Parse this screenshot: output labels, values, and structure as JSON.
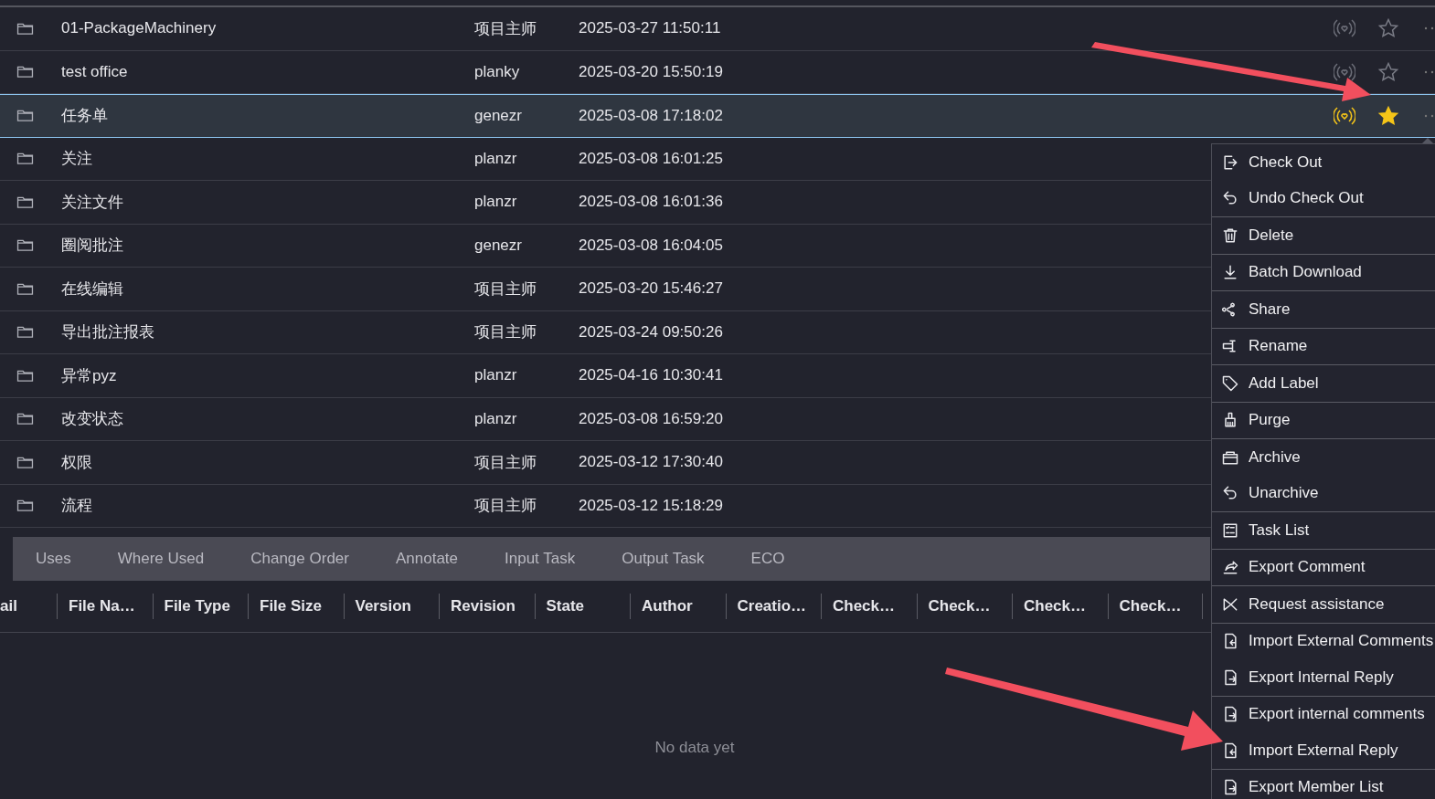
{
  "rows": [
    {
      "name": "01-PackageMachinery",
      "owner": "项目主师",
      "date": "2025-03-27 11:50:11",
      "selected": false,
      "subscribed": false,
      "favorite": false
    },
    {
      "name": "test office",
      "owner": "planky",
      "date": "2025-03-20 15:50:19",
      "selected": false,
      "subscribed": false,
      "favorite": false
    },
    {
      "name": "任务单",
      "owner": "genezr",
      "date": "2025-03-08 17:18:02",
      "selected": true,
      "subscribed": true,
      "favorite": true
    },
    {
      "name": "关注",
      "owner": "planzr",
      "date": "2025-03-08 16:01:25",
      "selected": false
    },
    {
      "name": "关注文件",
      "owner": "planzr",
      "date": "2025-03-08 16:01:36",
      "selected": false
    },
    {
      "name": "圈阅批注",
      "owner": "genezr",
      "date": "2025-03-08 16:04:05",
      "selected": false
    },
    {
      "name": "在线编辑",
      "owner": "项目主师",
      "date": "2025-03-20 15:46:27",
      "selected": false
    },
    {
      "name": "导出批注报表",
      "owner": "项目主师",
      "date": "2025-03-24 09:50:26",
      "selected": false
    },
    {
      "name": "异常pyz",
      "owner": "planzr",
      "date": "2025-04-16 10:30:41",
      "selected": false
    },
    {
      "name": "改变状态",
      "owner": "planzr",
      "date": "2025-03-08 16:59:20",
      "selected": false
    },
    {
      "name": "权限",
      "owner": "项目主师",
      "date": "2025-03-12 17:30:40",
      "selected": false
    },
    {
      "name": "流程",
      "owner": "项目主师",
      "date": "2025-03-12 15:18:29",
      "selected": false
    }
  ],
  "tabs": [
    {
      "label": "Uses",
      "selected": false
    },
    {
      "label": "Where Used",
      "selected": false
    },
    {
      "label": "Change Order",
      "selected": false
    },
    {
      "label": "Annotate",
      "selected": false
    },
    {
      "label": "Input Task",
      "selected": false
    },
    {
      "label": "Output Task",
      "selected": false
    },
    {
      "label": "ECO",
      "selected": false
    }
  ],
  "table": {
    "columns": [
      "ail",
      "File Na…",
      "File Type",
      "File Size",
      "Version",
      "Revision",
      "State",
      "Author",
      "Creatio…",
      "Check…",
      "Check…",
      "Check…",
      "Check…"
    ],
    "empty_text": "No data yet"
  },
  "context_menu": {
    "groups": [
      [
        "Check Out",
        "Undo Check Out"
      ],
      [
        "Delete"
      ],
      [
        "Batch Download"
      ],
      [
        "Share"
      ],
      [
        "Rename"
      ],
      [
        "Add Label"
      ],
      [
        "Purge"
      ],
      [
        "Archive",
        "Unarchive"
      ],
      [
        "Task List"
      ],
      [
        "Export Comment"
      ],
      [
        "Request assistance"
      ],
      [
        "Import External Comments",
        "Export Internal Reply"
      ],
      [
        "Export internal comments",
        "Import External Reply"
      ],
      [
        "Export Member List"
      ]
    ]
  }
}
